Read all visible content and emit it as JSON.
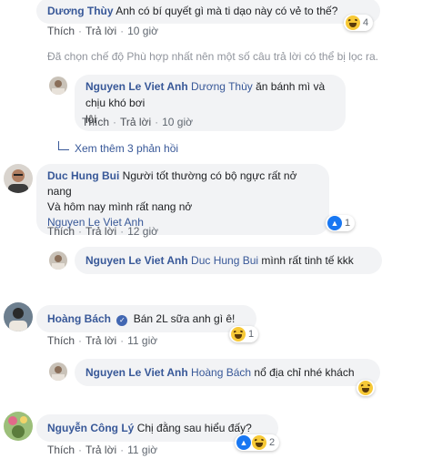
{
  "comments": [
    {
      "author": "Dương Thùy",
      "text": "Anh có bí quyết gì mà ti dạo này có vẻ to thế?",
      "react_count": "4",
      "like_label": "Thích",
      "reply_label": "Trả lời",
      "time": "10 giờ"
    },
    {
      "author": "Duc Hung Bui",
      "text_line1": "Người tốt thường có bộ ngực rất nở nang",
      "text_line2": "Và hôm nay mình rất nang nở",
      "mention": "Nguyen Le Viet Anh",
      "react_count": "1",
      "like_label": "Thích",
      "reply_label": "Trả lời",
      "time": "12 giờ"
    },
    {
      "author": "Hoàng Bách",
      "text": "Bán 2L sữa anh gì ê!",
      "react_count": "1",
      "like_label": "Thích",
      "reply_label": "Trả lời",
      "time": "11 giờ"
    },
    {
      "author": "Nguyễn Công Lý",
      "text": "Chị đằng sau hiểu đấy?",
      "react_count": "2",
      "like_label": "Thích",
      "reply_label": "Trả lời",
      "time": "11 giờ"
    }
  ],
  "replies": [
    {
      "author": "Nguyen Le Viet Anh",
      "mention": "Dương Thùy",
      "text_line1": "ăn bánh mì và chịu khó bơi",
      "text_line2": "lội",
      "like_label": "Thích",
      "reply_label": "Trả lời",
      "time": "10 giờ"
    },
    {
      "author": "Nguyen Le Viet Anh",
      "mention": "Duc Hung Bui",
      "text": "mình rất tinh tế kkk"
    },
    {
      "author": "Nguyen Le Viet Anh",
      "mention": "Hoàng Bách",
      "text": "nổ địa chỉ nhé khách"
    }
  ],
  "filter_notice": "Đã chọn chế độ Phù hợp nhất nên một số câu trả lời có thể bị lọc ra.",
  "see_more": "Xem thêm 3 phản hồi",
  "colors": {
    "link": "#385898",
    "bubble": "#f2f3f5",
    "meta": "#606770"
  }
}
